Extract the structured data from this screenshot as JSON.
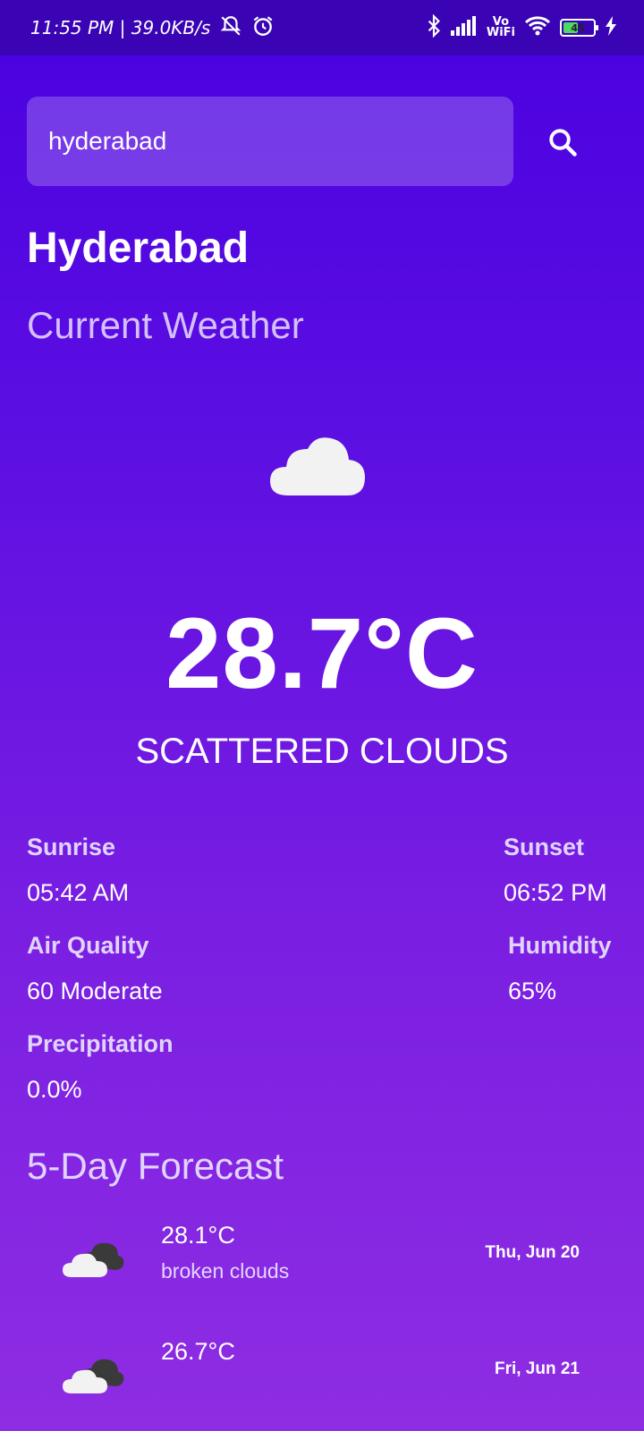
{
  "status_bar": {
    "time_speed": "11:55 PM | 39.0KB/s",
    "vowifi_top": "Vo",
    "vowifi_bottom": "WiFi",
    "battery": "45"
  },
  "search": {
    "value": "hyderabad",
    "icon": "search-icon"
  },
  "city": "Hyderabad",
  "current_label": "Current Weather",
  "current": {
    "icon": "cloud-icon",
    "temperature": "28.7°C",
    "condition": "SCATTERED CLOUDS"
  },
  "stats": {
    "sunrise_label": "Sunrise",
    "sunrise_value": "05:42 AM",
    "sunset_label": "Sunset",
    "sunset_value": "06:52 PM",
    "air_quality_label": "Air Quality",
    "air_quality_value": "60 Moderate",
    "humidity_label": "Humidity",
    "humidity_value": "65%",
    "precipitation_label": "Precipitation",
    "precipitation_value": "0.0%"
  },
  "forecast_title": "5-Day Forecast",
  "forecast": [
    {
      "icon": "broken-clouds-icon",
      "temp": "28.1°C",
      "desc": "broken clouds",
      "date": "Thu, Jun 20"
    },
    {
      "icon": "broken-clouds-icon",
      "temp": "26.7°C",
      "desc": "",
      "date": "Fri, Jun 21"
    }
  ],
  "colors": {
    "gradient_top": "#4a00e0",
    "gradient_bottom": "#8e2de2",
    "status_bar": "#3a04b5"
  }
}
